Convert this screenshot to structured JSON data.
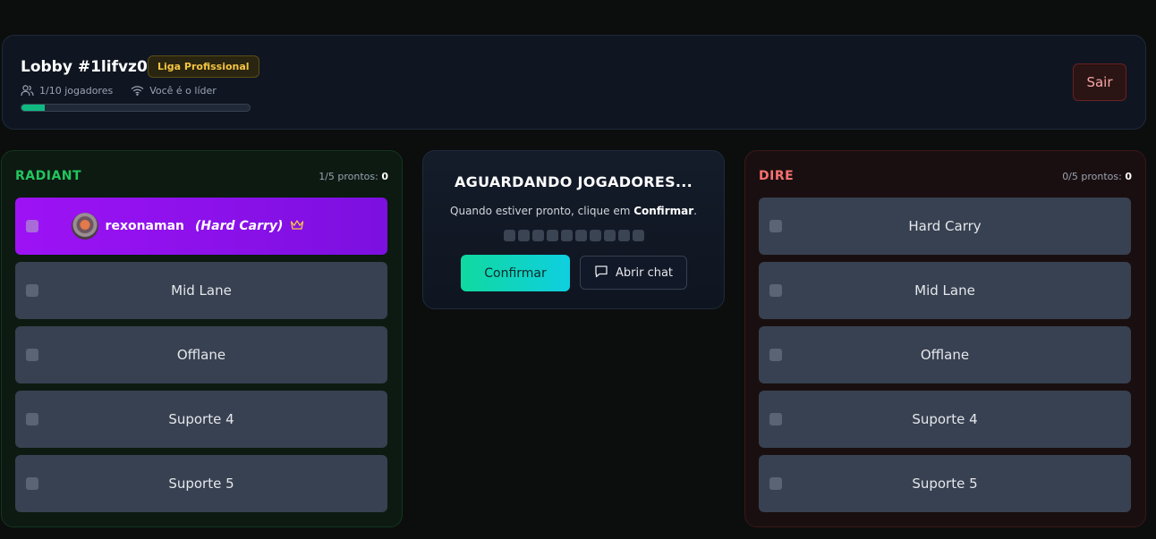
{
  "header": {
    "lobby_title": "Lobby #1lifvz05",
    "league_badge": "Liga Profissional",
    "players_count": "1/10 jogadores",
    "leader_text": "Você é o líder",
    "progress_fraction": 0.1,
    "exit_label": "Sair"
  },
  "radiant": {
    "name": "RADIANT",
    "ready_label": "1/5 prontos:",
    "ready_value": "0",
    "player_name": "rexonaman",
    "player_role": "(Hard Carry)",
    "slots": [
      "Mid Lane",
      "Offlane",
      "Suporte 4",
      "Suporte 5"
    ]
  },
  "dire": {
    "name": "DIRE",
    "ready_label": "0/5 prontos:",
    "ready_value": "0",
    "slots": [
      "Hard Carry",
      "Mid Lane",
      "Offlane",
      "Suporte 4",
      "Suporte 5"
    ]
  },
  "center": {
    "title": "AGUARDANDO JOGADORES...",
    "text_before": "Quando estiver pronto, clique em ",
    "text_bold": "Confirmar",
    "text_after": ".",
    "confirm_label": "Confirmar",
    "chat_label": "Abrir chat"
  },
  "colors": {
    "radiant": "#22c55e",
    "dire": "#f87171",
    "accent": "#10d9a0",
    "player_slot": "#9d12f5",
    "badge": "#f5c542"
  },
  "icons": {
    "players": "users-icon",
    "leader": "wifi-icon",
    "crown": "crown-icon",
    "chat": "chat-bubble-icon"
  }
}
